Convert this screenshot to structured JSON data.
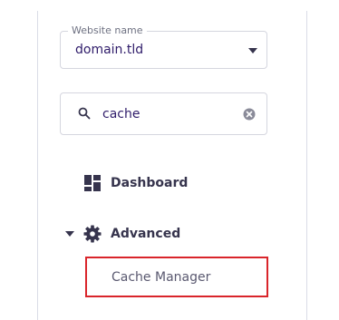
{
  "website_select": {
    "label": "Website name",
    "value": "domain.tld"
  },
  "search": {
    "value": "cache"
  },
  "nav": {
    "dashboard_label": "Dashboard",
    "advanced_label": "Advanced",
    "advanced_expanded": true,
    "sub_items": [
      {
        "label": "Cache Manager",
        "highlighted": true
      }
    ]
  },
  "colors": {
    "text_primary": "#36344d",
    "highlight_border": "#d9252b",
    "field_border": "#d5d6df"
  },
  "icons": {
    "dashboard": "dashboard-grid-icon",
    "advanced": "gear-icon",
    "search": "search-icon",
    "clear": "clear-icon",
    "select_caret": "chevron-down-icon",
    "expand_caret": "caret-down-icon"
  }
}
